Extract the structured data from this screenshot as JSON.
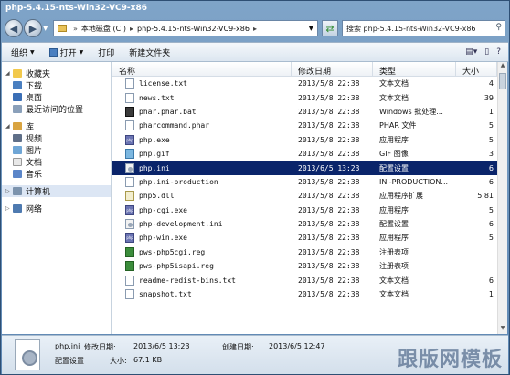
{
  "window": {
    "title": "php-5.4.15-nts-Win32-VC9-x86"
  },
  "address": {
    "segments": [
      "本地磁盘 (C:)",
      "php-5.4.15-nts-Win32-VC9-x86"
    ],
    "search_text": "搜索 php-5.4.15-nts-Win32-VC9-x86"
  },
  "toolbar": {
    "organize": "组织",
    "open": "打开",
    "print": "打印",
    "new_folder": "新建文件夹"
  },
  "nav": {
    "favorites": "收藏夹",
    "downloads": "下载",
    "desktop": "桌面",
    "recent": "最近访问的位置",
    "libraries": "库",
    "videos": "视频",
    "pictures": "图片",
    "documents": "文档",
    "music": "音乐",
    "computer": "计算机",
    "network": "网络"
  },
  "columns": {
    "name": "名称",
    "date": "修改日期",
    "type": "类型",
    "size": "大小"
  },
  "files": [
    {
      "name": "license.txt",
      "date": "2013/5/8 22:38",
      "type": "文本文档",
      "size": "4",
      "icon": "text-file-icon"
    },
    {
      "name": "news.txt",
      "date": "2013/5/8 22:38",
      "type": "文本文档",
      "size": "39",
      "icon": "text-file-icon"
    },
    {
      "name": "phar.phar.bat",
      "date": "2013/5/8 22:38",
      "type": "Windows 批处理...",
      "size": "1",
      "icon": "batch-file-icon"
    },
    {
      "name": "pharcommand.phar",
      "date": "2013/5/8 22:38",
      "type": "PHAR 文件",
      "size": "5",
      "icon": "text-file-icon"
    },
    {
      "name": "php.exe",
      "date": "2013/5/8 22:38",
      "type": "应用程序",
      "size": "5",
      "icon": "php-exe-icon"
    },
    {
      "name": "php.gif",
      "date": "2013/5/8 22:38",
      "type": "GIF 图像",
      "size": "3",
      "icon": "image-file-icon"
    },
    {
      "name": "php.ini",
      "date": "2013/6/5 13:23",
      "type": "配置设置",
      "size": "6",
      "icon": "ini-file-icon"
    },
    {
      "name": "php.ini-production",
      "date": "2013/5/8 22:38",
      "type": "INI-PRODUCTION...",
      "size": "6",
      "icon": "text-file-icon"
    },
    {
      "name": "php5.dll",
      "date": "2013/5/8 22:38",
      "type": "应用程序扩展",
      "size": "5,81",
      "icon": "dll-file-icon"
    },
    {
      "name": "php-cgi.exe",
      "date": "2013/5/8 22:38",
      "type": "应用程序",
      "size": "5",
      "icon": "php-exe-icon"
    },
    {
      "name": "php-development.ini",
      "date": "2013/5/8 22:38",
      "type": "配置设置",
      "size": "6",
      "icon": "ini-file-icon"
    },
    {
      "name": "php-win.exe",
      "date": "2013/5/8 22:38",
      "type": "应用程序",
      "size": "5",
      "icon": "php-exe-icon"
    },
    {
      "name": "pws-php5cgi.reg",
      "date": "2013/5/8 22:38",
      "type": "注册表项",
      "size": "",
      "icon": "registry-file-icon"
    },
    {
      "name": "pws-php5isapi.reg",
      "date": "2013/5/8 22:38",
      "type": "注册表项",
      "size": "",
      "icon": "registry-file-icon"
    },
    {
      "name": "readme-redist-bins.txt",
      "date": "2013/5/8 22:38",
      "type": "文本文档",
      "size": "6",
      "icon": "text-file-icon"
    },
    {
      "name": "snapshot.txt",
      "date": "2013/5/8 22:38",
      "type": "文本文档",
      "size": "1",
      "icon": "text-file-icon"
    }
  ],
  "selected_index": 6,
  "details": {
    "name": "php.ini",
    "modified_label": "修改日期:",
    "modified": "2013/6/5 13:23",
    "created_label": "创建日期:",
    "created": "2013/6/5 12:47",
    "type": "配置设置",
    "size_label": "大小:",
    "size": "67.1 KB"
  },
  "watermark": "跟版网模板"
}
